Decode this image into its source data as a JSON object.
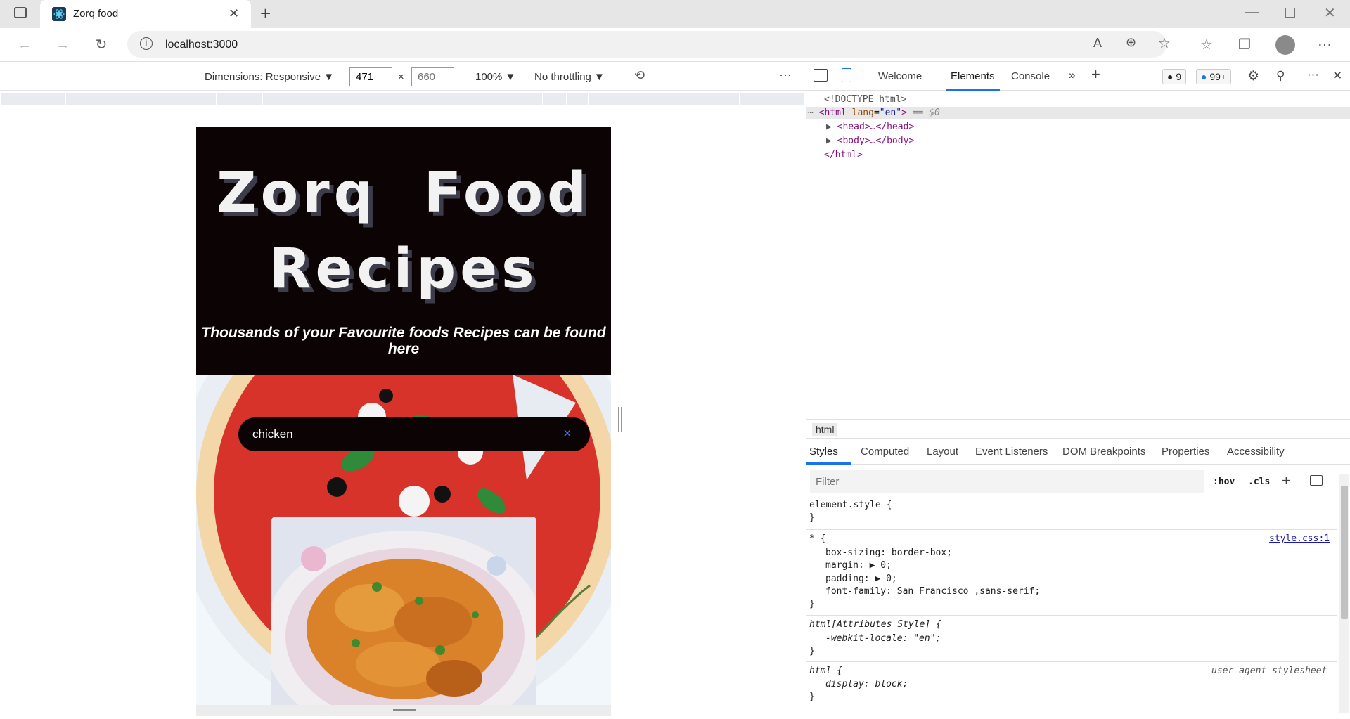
{
  "browser": {
    "tab_title": "Zorq food",
    "url": "localhost:3000"
  },
  "device_toolbar": {
    "dimensions_label": "Dimensions: Responsive",
    "width": "471",
    "height_placeholder": "660",
    "zoom": "100%",
    "throttling": "No throttling"
  },
  "page": {
    "title_line1": "Zorq  Food",
    "title_line2": "Recipes",
    "tagline": "Thousands of your Favourite foods Recipes can be found here",
    "search_value": "chicken",
    "clear_glyph": "×"
  },
  "devtools": {
    "tabs": [
      "Welcome",
      "Elements",
      "Console"
    ],
    "active_tab": "Elements",
    "issues_count": "9",
    "messages_count": "99+",
    "dom": {
      "doctype": "<!DOCTYPE html>",
      "html_open_tag": "<html",
      "html_attr": "lang",
      "html_attr_val": "\"en\"",
      "html_suffix": "== $0",
      "head": "<head>…</head>",
      "body": "<body>…</body>",
      "html_close": "</html>"
    },
    "breadcrumb": "html",
    "subtabs": [
      "Styles",
      "Computed",
      "Layout",
      "Event Listeners",
      "DOM Breakpoints",
      "Properties",
      "Accessibility"
    ],
    "filter_placeholder": "Filter",
    "hov_label": ":hov",
    "cls_label": ".cls",
    "styles": {
      "element_style_open": "element.style {",
      "close_brace": "}",
      "universal_open": "* {",
      "universal_source": "style.css:1",
      "box_sizing": "box-sizing: border-box;",
      "margin": "margin: ▶ 0;",
      "padding": "padding: ▶ 0;",
      "font_family": "font-family: San Francisco ,sans-serif;",
      "attr_style_open": "html[Attributes Style] {",
      "webkit_locale": "-webkit-locale: \"en\";",
      "html_open": "html {",
      "ua_label": "user agent stylesheet",
      "display": "display: block;"
    }
  }
}
